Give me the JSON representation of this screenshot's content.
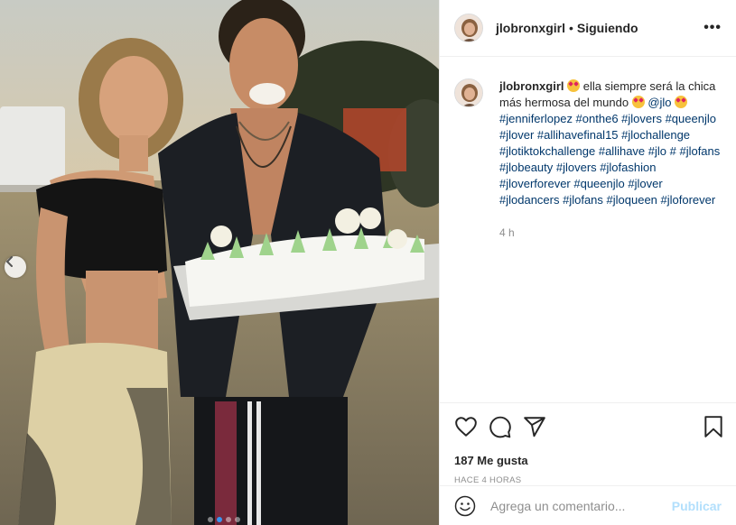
{
  "post": {
    "photo_alt": "",
    "dots_count": 4,
    "active_dot": 1
  },
  "header": {
    "username": "jlobronxgirl",
    "separator": "•",
    "follow_label": "Siguiendo",
    "more_label": "•••"
  },
  "caption": {
    "username": "jlobronxgirl",
    "text_part1": " ella siempre será la chica más hermosa del mundo ",
    "mention": "@jlo",
    "tags": "#jenniferlopez #onthe6 #jlovers #queenjlo #jlover #allihavefinal15 #jlochallenge #jlotiktokchallenge #allihave #jlo # #jlofans #jlobeauty #jlovers #jlofashion #jloverforever #queenjlo #jlover #jlodancers #jlofans #jloqueen #jloforever",
    "time": "4 h"
  },
  "actions": {
    "likes": "187 Me gusta",
    "posted": "HACE 4 HORAS"
  },
  "comment": {
    "placeholder": "Agrega un comentario...",
    "publish_label": "Publicar"
  },
  "colors": {
    "link": "#00376b",
    "publish_disabled": "#b2dffc",
    "secondary": "#8e8e8e",
    "dot_active": "#3897f0"
  }
}
